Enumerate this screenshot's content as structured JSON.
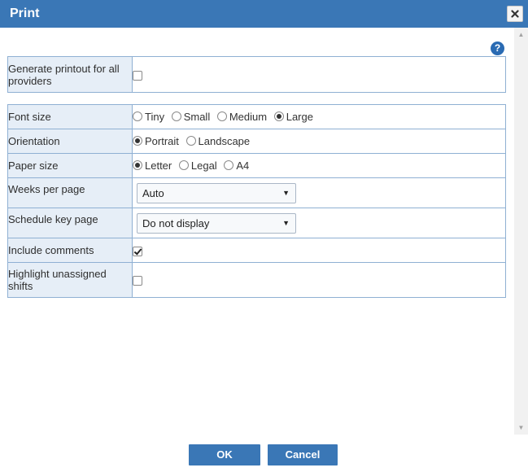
{
  "dialog": {
    "title": "Print",
    "help_glyph": "?",
    "close_icon": "close-icon",
    "help_icon": "question-circle-icon"
  },
  "providers": {
    "label": "Generate printout for all providers",
    "checked": false
  },
  "font_size": {
    "label": "Font size",
    "options": [
      {
        "label": "Tiny",
        "selected": false
      },
      {
        "label": "Small",
        "selected": false
      },
      {
        "label": "Medium",
        "selected": false
      },
      {
        "label": "Large",
        "selected": true
      }
    ]
  },
  "orientation": {
    "label": "Orientation",
    "options": [
      {
        "label": "Portrait",
        "selected": true
      },
      {
        "label": "Landscape",
        "selected": false
      }
    ]
  },
  "paper_size": {
    "label": "Paper size",
    "options": [
      {
        "label": "Letter",
        "selected": true
      },
      {
        "label": "Legal",
        "selected": false
      },
      {
        "label": "A4",
        "selected": false
      }
    ]
  },
  "weeks_per_page": {
    "label": "Weeks per page",
    "value": "Auto"
  },
  "schedule_key_page": {
    "label": "Schedule key page",
    "value": "Do not display"
  },
  "include_comments": {
    "label": "Include comments",
    "checked": true
  },
  "highlight_unassigned": {
    "label": "Highlight unassigned shifts",
    "checked": false
  },
  "buttons": {
    "ok": "OK",
    "cancel": "Cancel"
  },
  "colors": {
    "accent": "#3a77b6",
    "label_bg": "#e6eef7",
    "border": "#8fb0d3",
    "help": "#2a6bb3"
  }
}
